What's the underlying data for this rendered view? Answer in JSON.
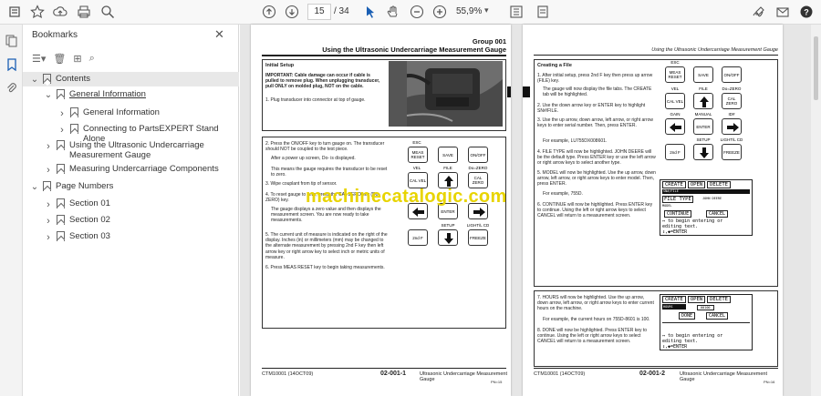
{
  "toolbar": {
    "page_current": "15",
    "page_total": "/ 34",
    "zoom": "55,9%"
  },
  "panel": {
    "title": "Bookmarks",
    "close": "✕"
  },
  "tree": [
    {
      "label": "Contents",
      "level": 0,
      "expanded": true,
      "selected": true,
      "underline": false
    },
    {
      "label": "General Information",
      "level": 1,
      "expanded": true,
      "underline": true
    },
    {
      "label": "General Information",
      "level": 2,
      "expanded": false,
      "underline": false
    },
    {
      "label": "Connecting to PartsEXPERT Stand Alone",
      "level": 2,
      "expanded": false,
      "underline": false
    },
    {
      "label": "Using the Ultrasonic Undercarriage Measurement Gauge",
      "level": 1,
      "expanded": false,
      "underline": false
    },
    {
      "label": "Measuring Undercarriage Components",
      "level": 1,
      "expanded": false,
      "underline": false
    },
    {
      "label": "Page Numbers",
      "level": 0,
      "expanded": true,
      "underline": false
    },
    {
      "label": "Section 01",
      "level": 1,
      "expanded": false,
      "underline": false
    },
    {
      "label": "Section 02",
      "level": 1,
      "expanded": false,
      "underline": false
    },
    {
      "label": "Section 03",
      "level": 1,
      "expanded": false,
      "underline": false
    }
  ],
  "left_page": {
    "group": "Group 001",
    "title": "Using the Ultrasonic Undercarriage Measurement Gauge",
    "initial_setup": "Initial Setup",
    "important": "IMPORTANT: Cable damage can occur if cable is pulled to remove plug. When unplugging transducer, pull ONLY on molded plug, NOT on the cable.",
    "step1": "1. Plug transducer into connector at top of gauge.",
    "step2": "2. Press the ON/OFF key to turn gauge on. The transducer should NOT be coupled to the test piece.",
    "step2b": "After a power up screen, Do- is displayed.",
    "step2c": "This means the gauge requires the transducer to be reset to zero.",
    "step3": "3. Wipe couplant from tip of sensor.",
    "step4": "4. To reset gauge to zero, press the CAL ZERO key (Do-ZERO) key.",
    "step4b": "The gauge displays a zero value and then displays the measurement screen. You are now ready to take measurements.",
    "step5": "5. The current unit of measure is indicated on the right of the display. Inches (in) or millimeters (mm) may be changed to the alternate measurement by pressing 2nd F key then left arrow key or right arrow key to select inch or metric units of measure.",
    "step6": "6. Press MEAS RESET key to begin taking measurements.",
    "footer_left": "CTM10001 (14OCT09)",
    "footer_code": "02-001-1",
    "footer_title": "Ultrasonic Undercarriage Measurement Gauge",
    "footer_page": "PN=15"
  },
  "right_page": {
    "header": "Using the Ultrasonic Undercarriage Measurement Gauge",
    "creating": "Creating a File",
    "s1": "1. After initial setup, press 2nd F key then press up arrow (FILE) key.",
    "s1b": "The gauge will now display the file tabs. The CREATE tab will be highlighted.",
    "s2": "2. Use the down arrow key or ENTER key to highlight SN#/FILE.",
    "s3": "3. Use the up arrow, down arrow, left arrow, or right arrow keys to enter serial number. Then, press ENTER.",
    "s3b": "For example, LU755DX008601.",
    "s4": "4. FILE TYPE will now be highlighted. JOHN DEERE will be the default type. Press ENTER key or use the left arrow or right arrow keys to select another type.",
    "s5": "5. MODEL will now be highlighted. Use the up arrow, down arrow, left arrow, or right arrow keys to enter model. Then, press ENTER.",
    "s5b": "For example, 755D.",
    "s6": "6. CONTINUE will now be highlighted. Press ENTER key to continue. Using the left or right arrow keys to select CANCEL will return to a measurement screen.",
    "s7": "7. HOURS will now be highlighted. Use the up arrow, down arrow, left arrow, or right arrow keys to enter current hours on the machine.",
    "s7b": "For example, the current hours on 755D-8601 is 100.",
    "s8": "8. DONE will now be highlighted. Press ENTER key to continue. Using the left or right arrow keys to select CANCEL will return to a measurement screen.",
    "footer_left": "CTM10001 (14OCT09)",
    "footer_code": "02-001-2",
    "footer_title": "Ultrasonic Undercarriage Measurement Gauge",
    "footer_page": "PN=16"
  },
  "keys": {
    "esc": "ESC",
    "meas_reset": "MEAS RESET",
    "save": "SAVE",
    "on_off": "ON/OFF",
    "vel": "VEL",
    "file": "FILE",
    "do_zero": "Do=ZERO",
    "cal_vel": "CAL VEL",
    "cal_zero": "CAL ZERO",
    "enter": "ENTER",
    "gain": "GAIN",
    "manual": "MANUAL",
    "id": "ID#",
    "setup": "SETUP",
    "light": "LIGHT/L CD",
    "second_f": "2nd F",
    "freeze": "FREEZE"
  },
  "lcd1": {
    "tabs": [
      "CREATE",
      "OPEN",
      "DELETE"
    ],
    "sn_label": "SN#/FILE",
    "file_type": "FILE TYPE",
    "file_type_val": "JOHN DEERE",
    "model": "MODEL",
    "cont": "CONTINUE",
    "cancel": "CANCEL",
    "hint1": "↔ to begin entering or",
    "hint2": "editing text.",
    "hint3": "↕,◆=ENTER"
  },
  "lcd2": {
    "tabs": [
      "CREATE",
      "OPEN",
      "DELETE"
    ],
    "hours": "HOURS",
    "hours_val": "00100",
    "done": "DONE",
    "cancel": "CANCEL",
    "hint1": "↔ to begin entering or",
    "hint2": "editing text.",
    "hint3": "↕,◆=ENTER"
  },
  "watermark": "machinecatalogic.com"
}
